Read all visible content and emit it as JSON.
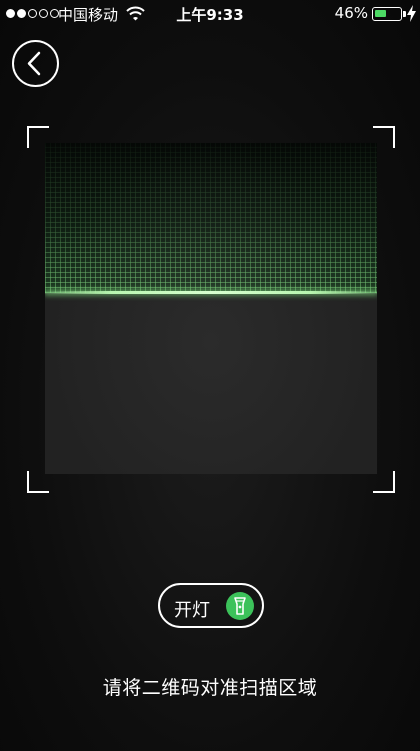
{
  "status_bar": {
    "carrier": "中国移动",
    "time": "上午9:33",
    "battery_percent": "46%",
    "battery_level": 0.46,
    "signal_bars_filled": 2,
    "signal_bars_total": 5,
    "icons": [
      "signal-dots-icon",
      "wifi-icon",
      "battery-icon",
      "charging-bolt-icon"
    ]
  },
  "nav": {
    "back_icon": "chevron-left-icon"
  },
  "scanner": {
    "accent_color": "#8fe58a",
    "frame_color": "#ffffff"
  },
  "light_toggle": {
    "label": "开灯",
    "icon": "flashlight-icon",
    "icon_bg_color": "#3cc25a"
  },
  "hint": "请将二维码对准扫描区域"
}
